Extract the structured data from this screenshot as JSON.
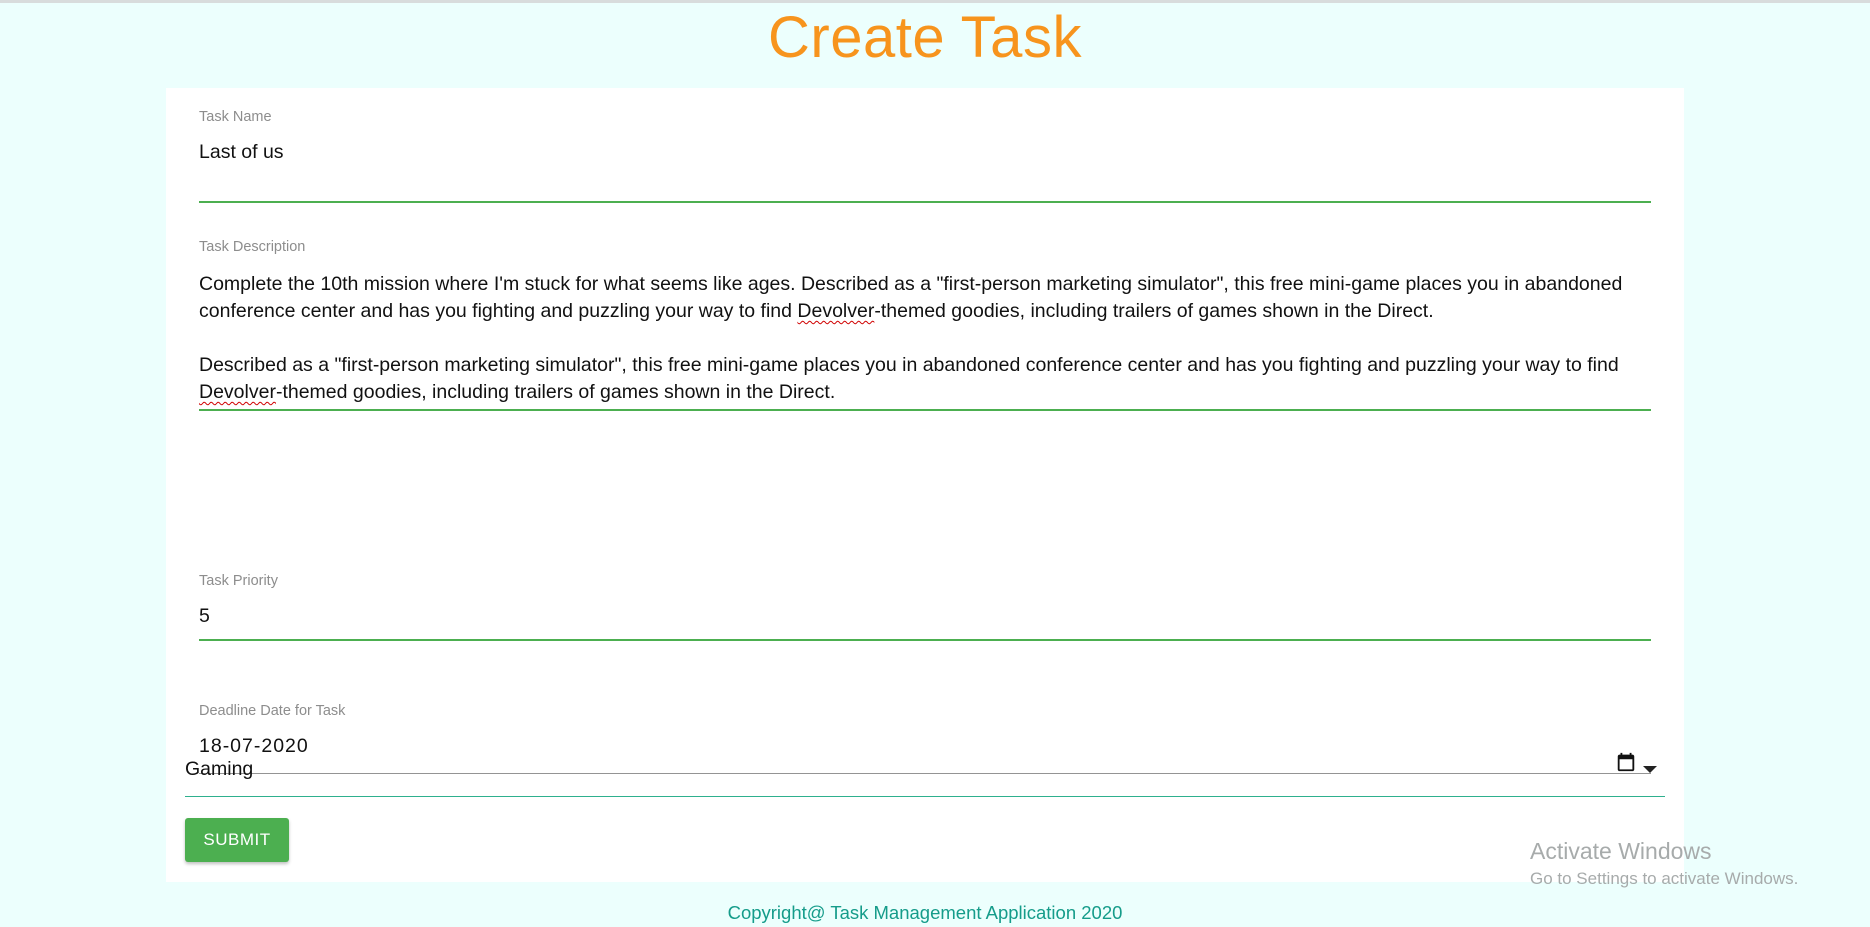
{
  "page": {
    "title": "Create Task",
    "title_color": "#f7941d",
    "background_color": "#ecfffd"
  },
  "form": {
    "task_name": {
      "label": "Task Name",
      "value": "Last of us"
    },
    "task_description": {
      "label": "Task Description",
      "paragraphs": [
        {
          "before": "Complete the 10th mission where I'm stuck for what seems like ages. Described as a \"first-person marketing simulator\", this free mini-game places you in abandoned conference center and has you fighting and puzzling your way to find ",
          "misspelled": "Devolver",
          "after": "-themed goodies, including trailers of games shown in the Direct."
        },
        {
          "before": "Described as a \"first-person marketing simulator\", this free mini-game places you in abandoned conference center and has you fighting and puzzling your way to find ",
          "misspelled": "Devolver",
          "after": "-themed goodies, including trailers of games shown in the Direct."
        }
      ]
    },
    "task_priority": {
      "label": "Task Priority",
      "value": "5"
    },
    "deadline": {
      "label": "Deadline Date for Task",
      "value": "18-07-2020",
      "icon": "calendar-icon"
    },
    "category": {
      "selected": "Gaming",
      "icon": "caret-down-icon"
    },
    "submit_label": "SUBMIT",
    "accent_color": "#4caf50"
  },
  "footer": {
    "text": "Copyright@ Task Management Application 2020",
    "color": "#159c8a"
  },
  "watermark": {
    "title": "Activate Windows",
    "subtitle": "Go to Settings to activate Windows."
  }
}
